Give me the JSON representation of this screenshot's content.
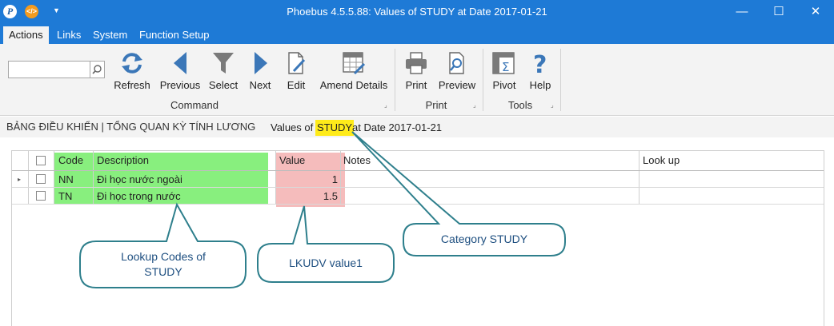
{
  "window": {
    "title": "Phoebus 4.5.5.88: Values of STUDY at Date 2017-01-21",
    "app_icon_glyph": "P",
    "code_icon_glyph": "</>",
    "quick_access_glyph": "▼",
    "minimize_glyph": "—",
    "maximize_glyph": "☐",
    "close_glyph": "✕"
  },
  "menu": {
    "tabs": [
      {
        "label": "Actions",
        "active": true
      },
      {
        "label": "Links"
      },
      {
        "label": "System"
      },
      {
        "label": "Function Setup"
      }
    ]
  },
  "ribbon": {
    "search": {
      "value": "",
      "placeholder": "",
      "icon": "search-icon"
    },
    "command": {
      "label": "Command",
      "buttons": [
        {
          "label": "Refresh",
          "icon": "refresh-icon"
        },
        {
          "label": "Previous",
          "icon": "previous-icon"
        },
        {
          "label": "Select",
          "icon": "filter-icon"
        },
        {
          "label": "Next",
          "icon": "next-icon"
        },
        {
          "label": "Edit",
          "icon": "edit-icon"
        },
        {
          "label": "Amend Details",
          "icon": "amend-details-icon"
        }
      ]
    },
    "print": {
      "label": "Print",
      "buttons": [
        {
          "label": "Print",
          "icon": "printer-icon"
        },
        {
          "label": "Preview",
          "icon": "preview-icon"
        }
      ]
    },
    "tools": {
      "label": "Tools",
      "buttons": [
        {
          "label": "Pivot",
          "icon": "pivot-icon"
        },
        {
          "label": "Help",
          "icon": "help-icon"
        }
      ]
    },
    "launcher_glyph": "⌟"
  },
  "breadcrumb": {
    "main": "BẢNG ĐIỀU KHIỂN | TỔNG QUAN KỲ TÍNH LƯƠNG",
    "prefix": "Values of",
    "category": "STUDY",
    "suffix": "at Date 2017-01-21"
  },
  "grid": {
    "columns": [
      "Code",
      "Description",
      "Value",
      "Notes",
      "Look up"
    ],
    "rows": [
      {
        "code": "NN",
        "description": "Đi học nước ngoài",
        "value": "1",
        "notes": "",
        "lookup": "",
        "current": true
      },
      {
        "code": "TN",
        "description": "Đi học trong nước",
        "value": "1.5",
        "notes": "",
        "lookup": "",
        "current": false
      }
    ],
    "row_indicator_glyph": "▸"
  },
  "callouts": [
    {
      "lines": [
        "Lookup Codes of",
        "STUDY"
      ]
    },
    {
      "lines": [
        "LKUDV value1"
      ]
    },
    {
      "lines": [
        "Category STUDY"
      ]
    }
  ],
  "colors": {
    "titlebar": "#1e7ad6",
    "highlight_green": "#88ef7e",
    "highlight_pink": "#f5bcbc",
    "highlight_yellow": "#ffeb1a",
    "callout_stroke": "#2e7f8c",
    "callout_text": "#1e4f80"
  }
}
